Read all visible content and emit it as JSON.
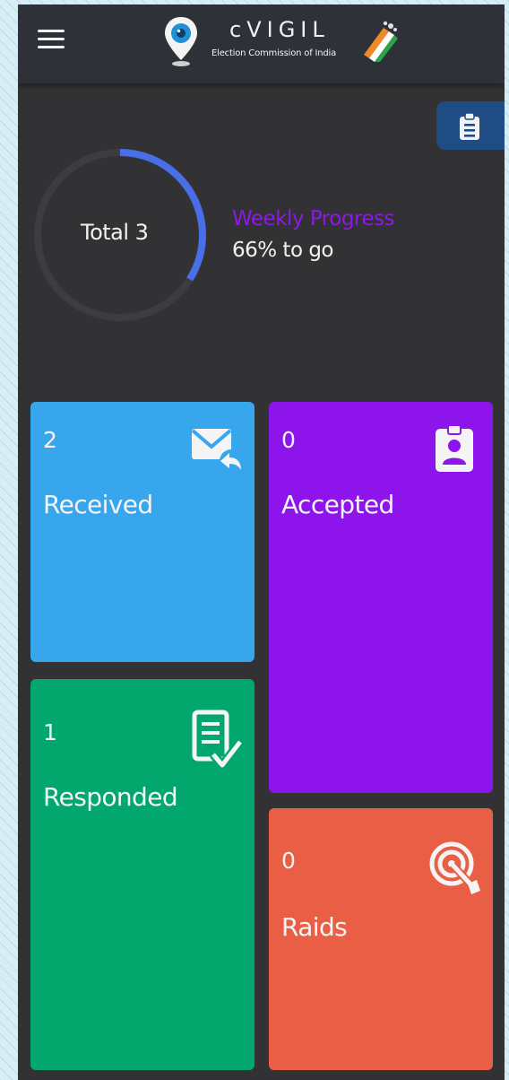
{
  "header": {
    "app_name": "cVIGIL",
    "subtitle": "Election Commission of India",
    "menu_icon": "hamburger-menu-icon",
    "logo_icon": "eye-location-pin-icon",
    "emblem_icon": "voting-ink-finger-icon"
  },
  "fab": {
    "icon": "clipboard-icon"
  },
  "progress": {
    "total_label": "Total 3",
    "title": "Weekly Progress",
    "subtitle": "66% to go",
    "completed_fraction": 0.34,
    "title_color": "#8d18e8",
    "ring_color": "#4a6ee8"
  },
  "tiles": [
    {
      "id": "received",
      "count": "2",
      "label": "Received",
      "icon": "mail-reply-icon",
      "color": "#38a6ec"
    },
    {
      "id": "accepted",
      "count": "0",
      "label": "Accepted",
      "icon": "id-badge-icon",
      "color": "#8e14ec"
    },
    {
      "id": "responded",
      "count": "1",
      "label": "Responded",
      "icon": "document-check-icon",
      "color": "#01a76c"
    },
    {
      "id": "raids",
      "count": "0",
      "label": "Raids",
      "icon": "target-icon",
      "color": "#e95f46"
    }
  ]
}
